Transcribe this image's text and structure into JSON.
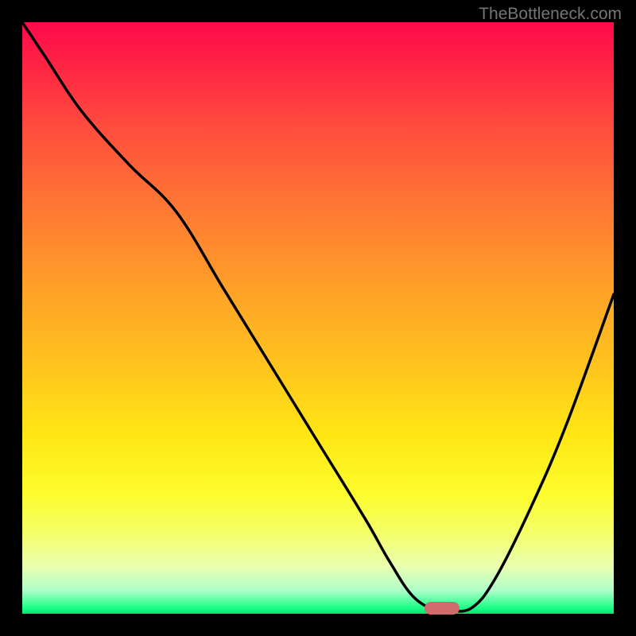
{
  "watermark": "TheBottleneck.com",
  "chart_data": {
    "type": "line",
    "title": "",
    "xlabel": "",
    "ylabel": "",
    "xlim": [
      0,
      100
    ],
    "ylim": [
      0,
      100
    ],
    "series": [
      {
        "name": "bottleneck-curve",
        "x": [
          0,
          4,
          10,
          18,
          26,
          34,
          42,
          50,
          58,
          62,
          66,
          70,
          72,
          76,
          80,
          86,
          92,
          100
        ],
        "y": [
          100,
          94,
          85,
          76,
          68,
          55,
          42,
          29,
          16,
          9,
          3,
          0.5,
          0.5,
          1,
          6,
          18,
          32,
          54
        ]
      }
    ],
    "marker": {
      "x": 71,
      "y": 1
    },
    "gradient_stops": [
      {
        "pos": 0,
        "color": "#ff0a4a"
      },
      {
        "pos": 18,
        "color": "#ff4d3d"
      },
      {
        "pos": 45,
        "color": "#ffa028"
      },
      {
        "pos": 70,
        "color": "#ffe714"
      },
      {
        "pos": 86,
        "color": "#f5ff66"
      },
      {
        "pos": 99,
        "color": "#1dff87"
      },
      {
        "pos": 100,
        "color": "#04e36b"
      }
    ]
  }
}
